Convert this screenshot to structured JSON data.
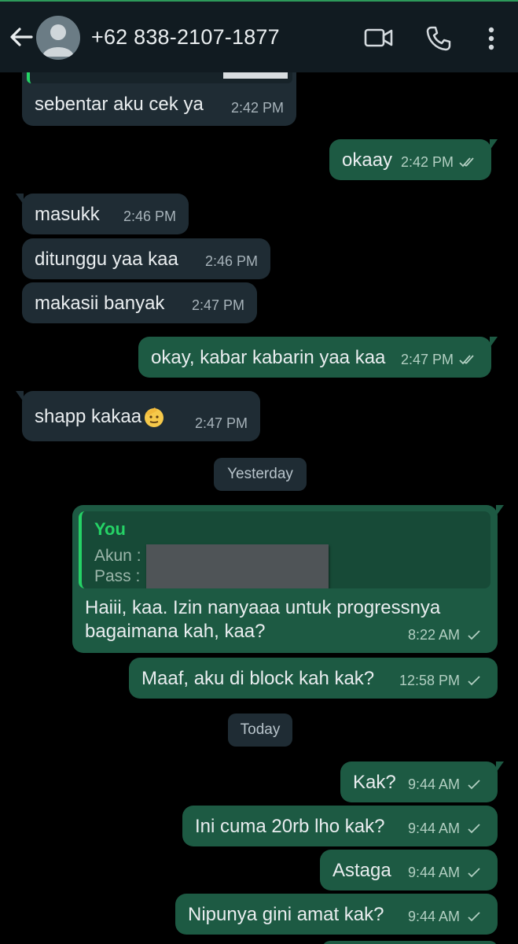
{
  "header": {
    "contact_name": "+62 838-2107-1877"
  },
  "messages": {
    "m0": {
      "text": "sebentar aku cek ya",
      "time": "2:42 PM"
    },
    "m1": {
      "text": "okaay",
      "time": "2:42 PM"
    },
    "m2": {
      "text": "masukk",
      "time": "2:46 PM"
    },
    "m3": {
      "text": "ditunggu yaa kaa",
      "time": "2:46 PM"
    },
    "m4": {
      "text": "makasii banyak",
      "time": "2:47 PM"
    },
    "m5": {
      "text": "okay, kabar kabarin yaa kaa",
      "time": "2:47 PM"
    },
    "m6": {
      "text": "shapp kakaa",
      "time": "2:47 PM"
    },
    "m7": {
      "reply_author": "You",
      "reply_line1": "Akun :",
      "reply_line2": "Pass :",
      "text_line1": "Haiii, kaa. Izin nanyaaa untuk progressnya",
      "text_line2": "bagaimana kah, kaa?",
      "time": "8:22 AM"
    },
    "m8": {
      "text": "Maaf, aku di block kah kak?",
      "time": "12:58 PM"
    },
    "m9": {
      "text": "Kak?",
      "time": "9:44 AM"
    },
    "m10": {
      "text": "Ini cuma 20rb lho kak?",
      "time": "9:44 AM"
    },
    "m11": {
      "text": "Astaga",
      "time": "9:44 AM"
    },
    "m12": {
      "text": "Nipunya gini amat kak?",
      "time": "9:44 AM"
    }
  },
  "dates": {
    "yesterday": "Yesterday",
    "today": "Today"
  },
  "colors": {
    "header_bg": "#111b21",
    "incoming_bubble": "#1f2c34",
    "outgoing_bubble": "#1d5a43",
    "reply_accent": "#25d366"
  },
  "icons": [
    "back-arrow-icon",
    "avatar-icon",
    "video-call-icon",
    "voice-call-icon",
    "more-options-icon",
    "double-check-icon",
    "single-check-icon",
    "saluting-face-emoji"
  ]
}
